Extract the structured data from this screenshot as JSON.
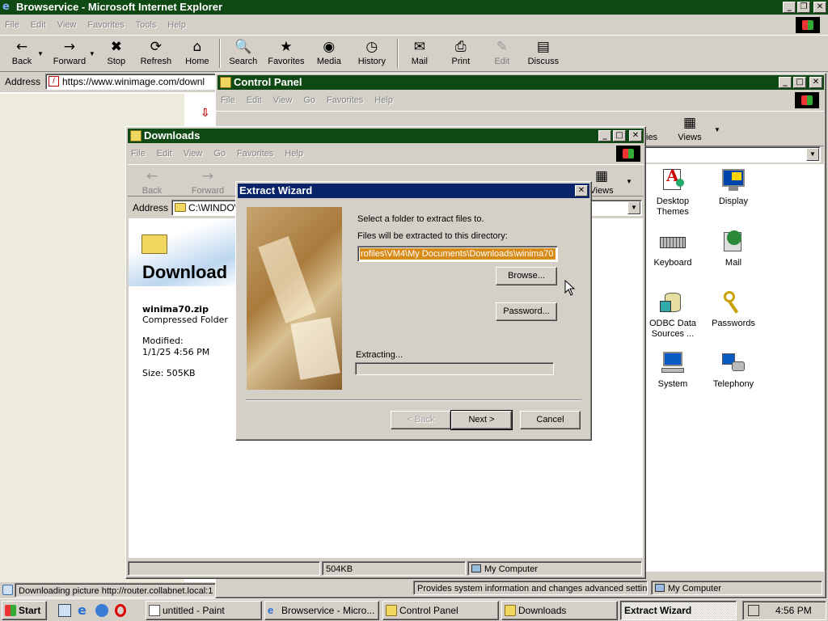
{
  "ie": {
    "title": "Browservice - Microsoft Internet Explorer",
    "menu": [
      "File",
      "Edit",
      "View",
      "Favorites",
      "Tools",
      "Help"
    ],
    "toolbar": [
      {
        "label": "Back",
        "icon": "←"
      },
      {
        "label": "Forward",
        "icon": "→"
      },
      {
        "label": "Stop",
        "icon": "✖"
      },
      {
        "label": "Refresh",
        "icon": "⟳"
      },
      {
        "label": "Home",
        "icon": "⌂"
      },
      {
        "label": "Search",
        "icon": "🔍"
      },
      {
        "label": "Favorites",
        "icon": "★"
      },
      {
        "label": "Media",
        "icon": "◉"
      },
      {
        "label": "History",
        "icon": "◷"
      },
      {
        "label": "Mail",
        "icon": "✉"
      },
      {
        "label": "Print",
        "icon": "⎙"
      },
      {
        "label": "Edit",
        "icon": "✎"
      },
      {
        "label": "Discuss",
        "icon": "▤"
      }
    ],
    "address_label": "Address",
    "address_value": "https://www.winimage.com/downl",
    "status_text": "Downloading picture http://router.collabnet.local:1"
  },
  "control_panel": {
    "title": "Control Panel",
    "menu": [
      "File",
      "Edit",
      "View",
      "Go",
      "Favorites",
      "Help"
    ],
    "views_label": "Views",
    "ies_label": "ies",
    "status_text": "Provides system information and changes advanced setting",
    "status_zone": "My Computer",
    "icons": [
      {
        "label": "Desktop Themes",
        "icon": "desktop-themes-icon"
      },
      {
        "label": "Display",
        "icon": "display-icon"
      },
      {
        "label": "Keyboard",
        "icon": "keyboard-icon"
      },
      {
        "label": "Mail",
        "icon": "mail-icon"
      },
      {
        "label": "ODBC Data Sources ...",
        "icon": "odbc-icon"
      },
      {
        "label": "Passwords",
        "icon": "passwords-icon"
      },
      {
        "label": "System",
        "icon": "system-icon"
      },
      {
        "label": "Telephony",
        "icon": "telephony-icon"
      }
    ]
  },
  "downloads": {
    "title": "Downloads",
    "menu": [
      "File",
      "Edit",
      "View",
      "Go",
      "Favorites",
      "Help"
    ],
    "toolbar": [
      {
        "label": "Back",
        "icon": "←"
      },
      {
        "label": "Forward",
        "icon": "→"
      }
    ],
    "views_label": "Views",
    "address_label": "Address",
    "address_value": "C:\\WINDOW",
    "heading": "Download",
    "file_name": "winima70.zip",
    "file_type": "Compressed Folder",
    "modified_label": "Modified:",
    "modified_value": "1/1/25 4:56 PM",
    "size_text": "Size: 505KB",
    "status_size": "504KB",
    "status_zone": "My Computer"
  },
  "wizard": {
    "title": "Extract Wizard",
    "prompt": "Select a folder to extract files to.",
    "dir_label": "Files will be extracted to this directory:",
    "dir_value": "rofiles\\VM4\\My Documents\\Downloads\\winima70",
    "browse_label": "Browse...",
    "password_label": "Password...",
    "extracting_label": "Extracting...",
    "progress": 0,
    "back_label": "< Back",
    "next_label": "Next >",
    "cancel_label": "Cancel"
  },
  "taskbar": {
    "start_label": "Start",
    "buttons": [
      {
        "label": "untitled - Paint"
      },
      {
        "label": "Browservice - Micro..."
      },
      {
        "label": "Control Panel"
      },
      {
        "label": "Downloads"
      },
      {
        "label": "Extract Wizard"
      }
    ],
    "clock": "4:56 PM"
  },
  "colors": {
    "title_green": "#0f4a14",
    "title_blue": "#0a246a",
    "selection": "#d98b1a"
  }
}
